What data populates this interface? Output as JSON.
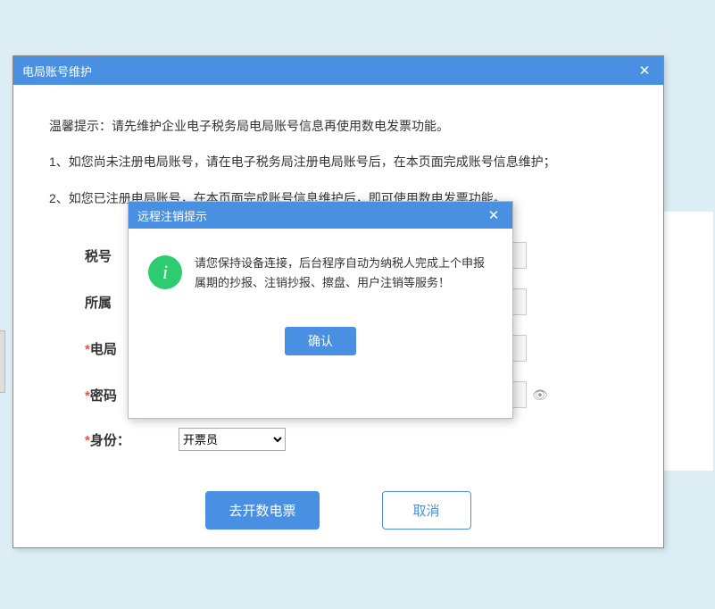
{
  "outer": {
    "title": "电局账号维护",
    "tip_line": "温馨提示：请先维护企业电子税务局电局账号信息再使用数电发票功能。",
    "line1": "1、如您尚未注册电局账号，请在电子税务局注册电局账号后，在本页面完成账号信息维护；",
    "line2": "2、如您已注册电局账号，在本页面完成账号信息维护后，即可使用数电发票功能。",
    "labels": {
      "tax_no": "税号",
      "region": "所属",
      "elec_account": "电局",
      "password": "密码",
      "role": "身份："
    },
    "role_value": "开票员",
    "btn_go": "去开数电票",
    "btn_cancel": "取消"
  },
  "inner": {
    "title": "远程注销提示",
    "message": "请您保持设备连接，后台程序自动为纳税人完成上个申报属期的抄报、注销抄报、擦盘、用户注销等服务！",
    "confirm": "确认"
  }
}
